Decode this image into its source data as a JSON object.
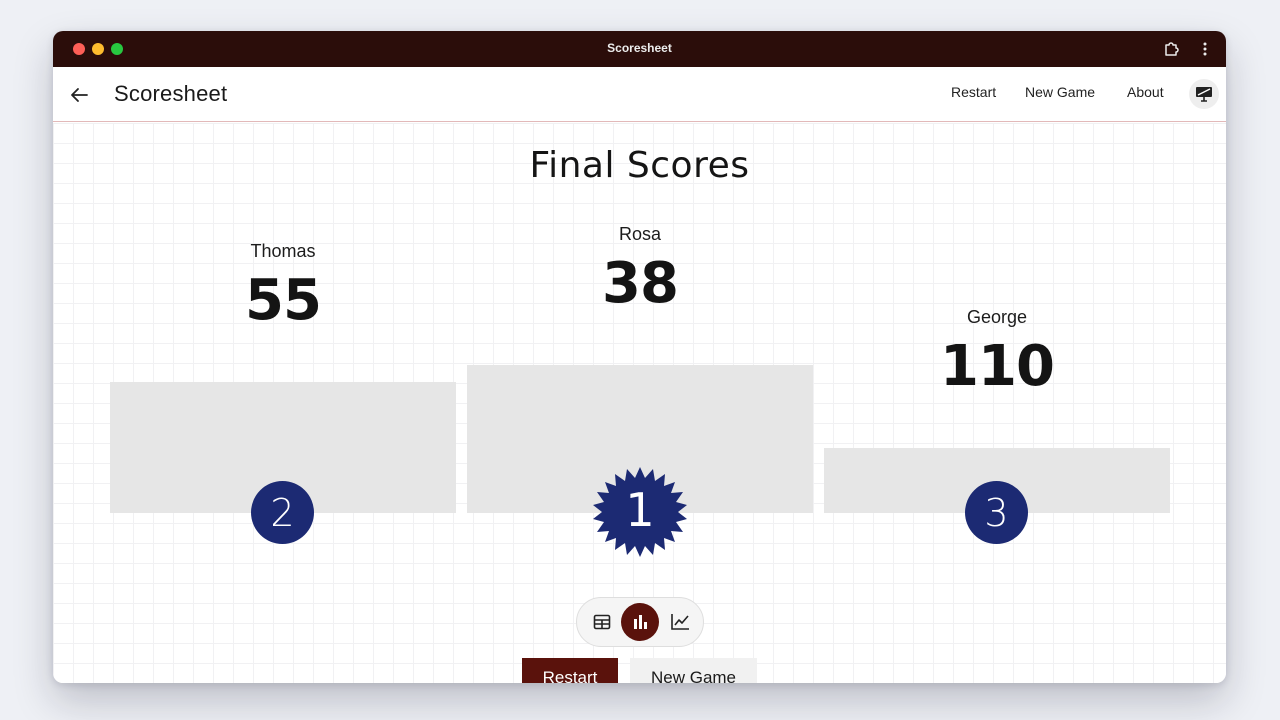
{
  "window": {
    "title": "Scoresheet"
  },
  "appbar": {
    "title": "Scoresheet",
    "nav": {
      "restart": "Restart",
      "new_game": "New Game",
      "about": "About"
    }
  },
  "main": {
    "title": "Final Scores",
    "podium": [
      {
        "name": "Thomas",
        "score": "55",
        "rank": "2"
      },
      {
        "name": "Rosa",
        "score": "38",
        "rank": "1"
      },
      {
        "name": "George",
        "score": "110",
        "rank": "3"
      }
    ],
    "view_toggle": {
      "options": [
        "table",
        "bar",
        "line"
      ],
      "selected": "bar"
    },
    "actions": {
      "restart": "Restart",
      "new_game": "New Game"
    }
  },
  "icons": {
    "back": "arrow-left-icon",
    "extensions": "puzzle-icon",
    "menu": "kebab-icon",
    "cast": "cast-icon"
  },
  "colors": {
    "titlebar": "#2b0d0a",
    "accent": "#5a120c",
    "badge": "#1c2a73",
    "podium_block": "#e6e6e6"
  }
}
